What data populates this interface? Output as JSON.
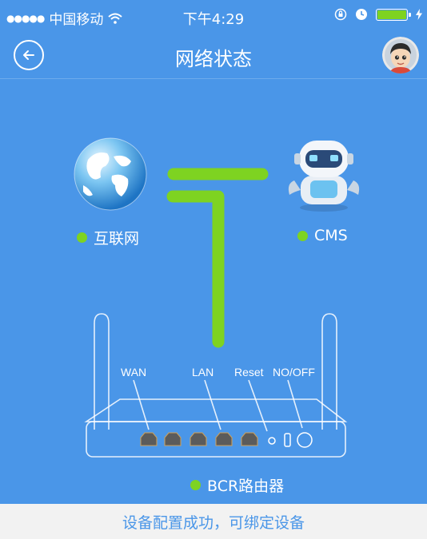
{
  "status_bar": {
    "signal_dots": "●●●●●",
    "carrier": "中国移动",
    "time": "下午4:29",
    "battery_color": "#7ed321"
  },
  "nav": {
    "title": "网络状态",
    "back_icon": "arrow-left-icon",
    "avatar_icon": "user-avatar"
  },
  "diagram": {
    "internet_label": "互联网",
    "cms_label": "CMS",
    "router_label": "BCR路由器",
    "ports": {
      "wan": "WAN",
      "lan": "LAN",
      "reset": "Reset",
      "power": "NO/OFF"
    },
    "status_color": "#7ed321"
  },
  "footer": {
    "message": "设备配置成功，可绑定设备"
  },
  "colors": {
    "background": "#4a96e8",
    "accent": "#7ed321",
    "footer_bg": "#f2f2f2"
  }
}
